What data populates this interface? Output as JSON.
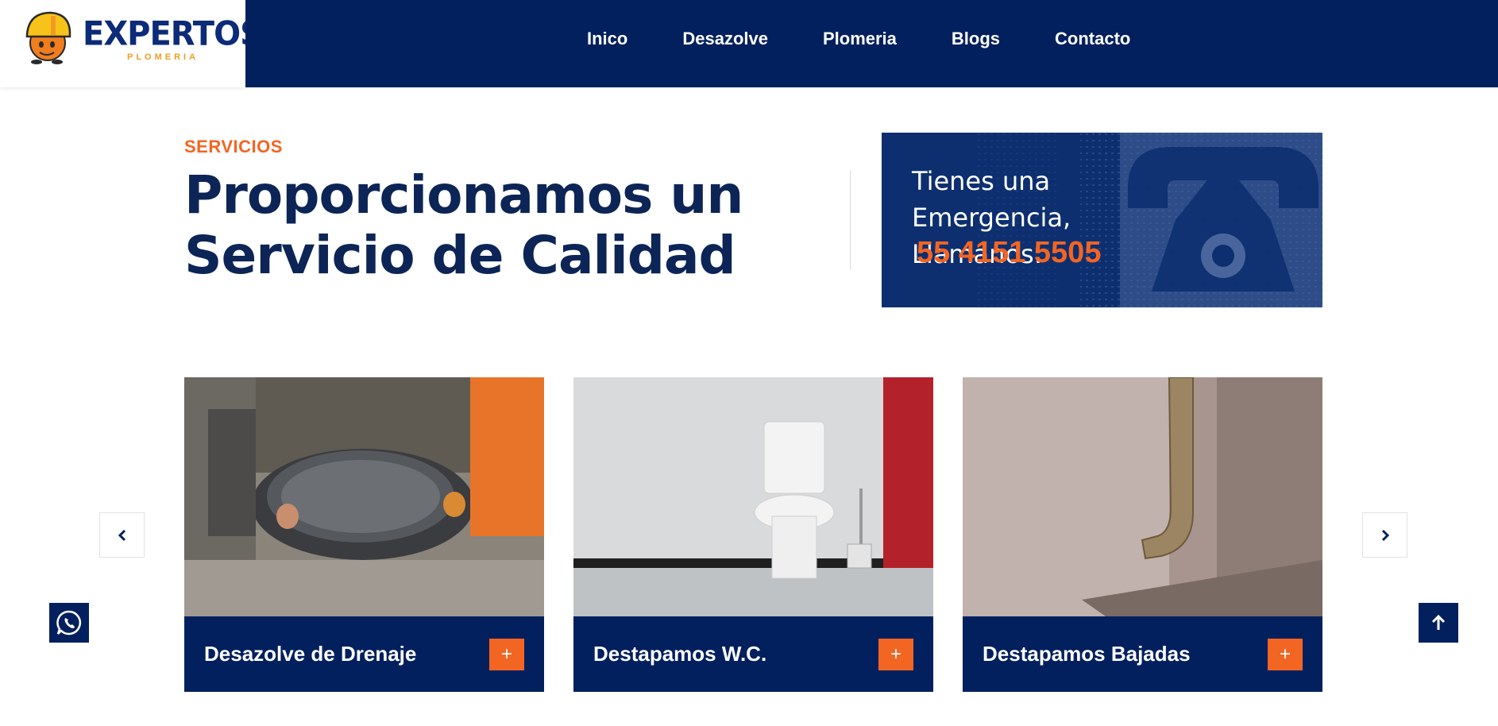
{
  "brand": {
    "name": "EXPERTOS",
    "tagline": "PLOMERIA",
    "colors": {
      "navy": "#03205e",
      "orange": "#f26522",
      "logo_blue": "#0c2b78",
      "logo_yellow": "#f29c1f"
    }
  },
  "nav": {
    "items": [
      {
        "label": "Inico"
      },
      {
        "label": "Desazolve"
      },
      {
        "label": "Plomeria"
      },
      {
        "label": "Blogs"
      },
      {
        "label": "Contacto"
      }
    ]
  },
  "section": {
    "kicker": "SERVICIOS",
    "headline_line1": "Proporcionamos un",
    "headline_line2": "Servicio de Calidad"
  },
  "emergency": {
    "text_line1": "Tienes una Emergencia,",
    "text_line2": "Llamanos:",
    "phone": "55 4151 5505"
  },
  "cards": [
    {
      "title": "Desazolve de Drenaje",
      "image": "manhole-install-photo",
      "button": "+"
    },
    {
      "title": "Destapamos W.C.",
      "image": "toilet-bathroom-photo",
      "button": "+"
    },
    {
      "title": "Destapamos Bajadas",
      "image": "downspout-pipe-photo",
      "button": "+"
    }
  ],
  "controls": {
    "prev_icon": "chevron-left-icon",
    "next_icon": "chevron-right-icon",
    "whatsapp_icon": "whatsapp-icon",
    "top_icon": "arrow-up-icon"
  }
}
